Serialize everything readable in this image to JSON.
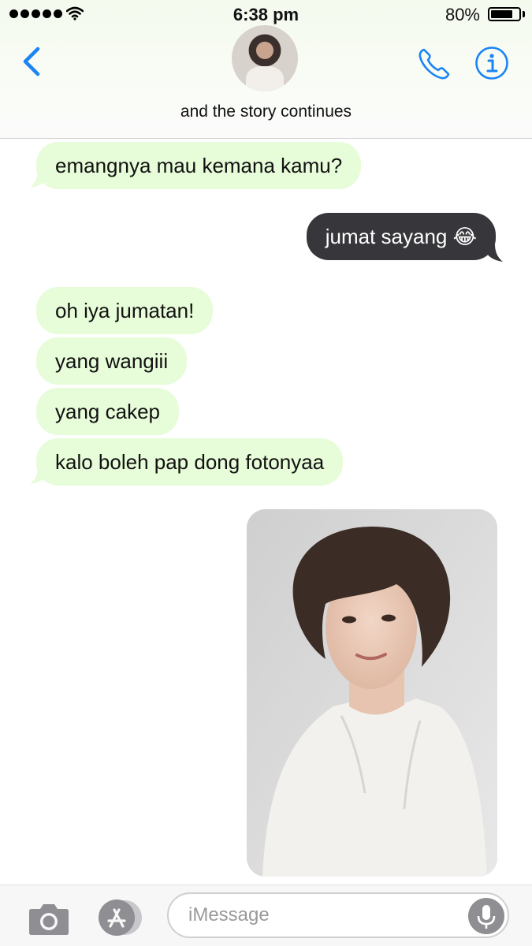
{
  "status_bar": {
    "time": "6:38 pm",
    "battery_percent": "80%",
    "battery_level": 0.8
  },
  "header": {
    "contact_name": "and the story continues",
    "back_icon": "chevron-left-icon",
    "call_icon": "phone-icon",
    "info_icon": "info-icon",
    "accent_color": "#1a84f5"
  },
  "messages": [
    {
      "direction": "incoming",
      "text": "emangnya mau kemana kamu?"
    },
    {
      "direction": "outgoing",
      "text": "jumat sayang 😂"
    },
    {
      "direction": "incoming",
      "text": "oh iya jumatan!"
    },
    {
      "direction": "incoming",
      "text": "yang wangiii"
    },
    {
      "direction": "incoming",
      "text": "yang cakep"
    },
    {
      "direction": "incoming",
      "text": "kalo boleh pap dong fotonyaa"
    }
  ],
  "photo_message": {
    "direction": "outgoing",
    "kind": "photo"
  },
  "composer": {
    "placeholder": "iMessage",
    "camera_icon": "camera-icon",
    "appstore_icon": "app-store-icon",
    "mic_icon": "microphone-icon"
  },
  "colors": {
    "incoming_bubble": "#e7fcd8",
    "outgoing_bubble": "#37373b",
    "header_background": "#f4faee"
  }
}
